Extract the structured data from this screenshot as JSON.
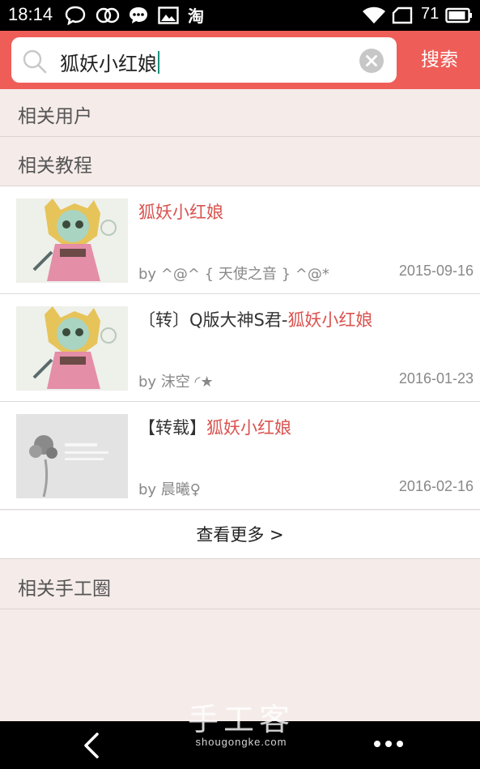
{
  "status_bar": {
    "time": "18:14",
    "battery_level": "71",
    "icons": [
      "chat-bubble-icon",
      "link-icon",
      "message-icon",
      "image-icon",
      "taobao-icon",
      "wifi-icon",
      "sim-icon",
      "battery-icon"
    ]
  },
  "search": {
    "query": "狐妖小红娘",
    "submit_label": "搜索"
  },
  "sections": {
    "related_users": "相关用户",
    "related_tutorials": "相关教程",
    "related_circles": "相关手工圈"
  },
  "tutorials": [
    {
      "title_prefix": "",
      "title_highlight": "狐妖小红娘",
      "author": "by ^@^ { 天使之音 } ^@*",
      "date": "2015-09-16",
      "thumb": "anime-fox-girl-drawing"
    },
    {
      "title_prefix": "〔转〕Q版大神S君-",
      "title_highlight": "狐妖小红娘",
      "author": "by 沫空 ◜★",
      "date": "2016-01-23",
      "thumb": "anime-fox-girl-drawing"
    },
    {
      "title_prefix": "【转载】",
      "title_highlight": "狐妖小红娘",
      "author": "by 晨曦♀",
      "date": "2016-02-16",
      "thumb": "grey-flower-card"
    }
  ],
  "more_label": "查看更多 >",
  "watermark": {
    "cn": "手工客",
    "en": "shougongke.com"
  },
  "colors": {
    "accent": "#ee5d57",
    "highlight": "#d9534f",
    "background": "#f5ecea"
  }
}
